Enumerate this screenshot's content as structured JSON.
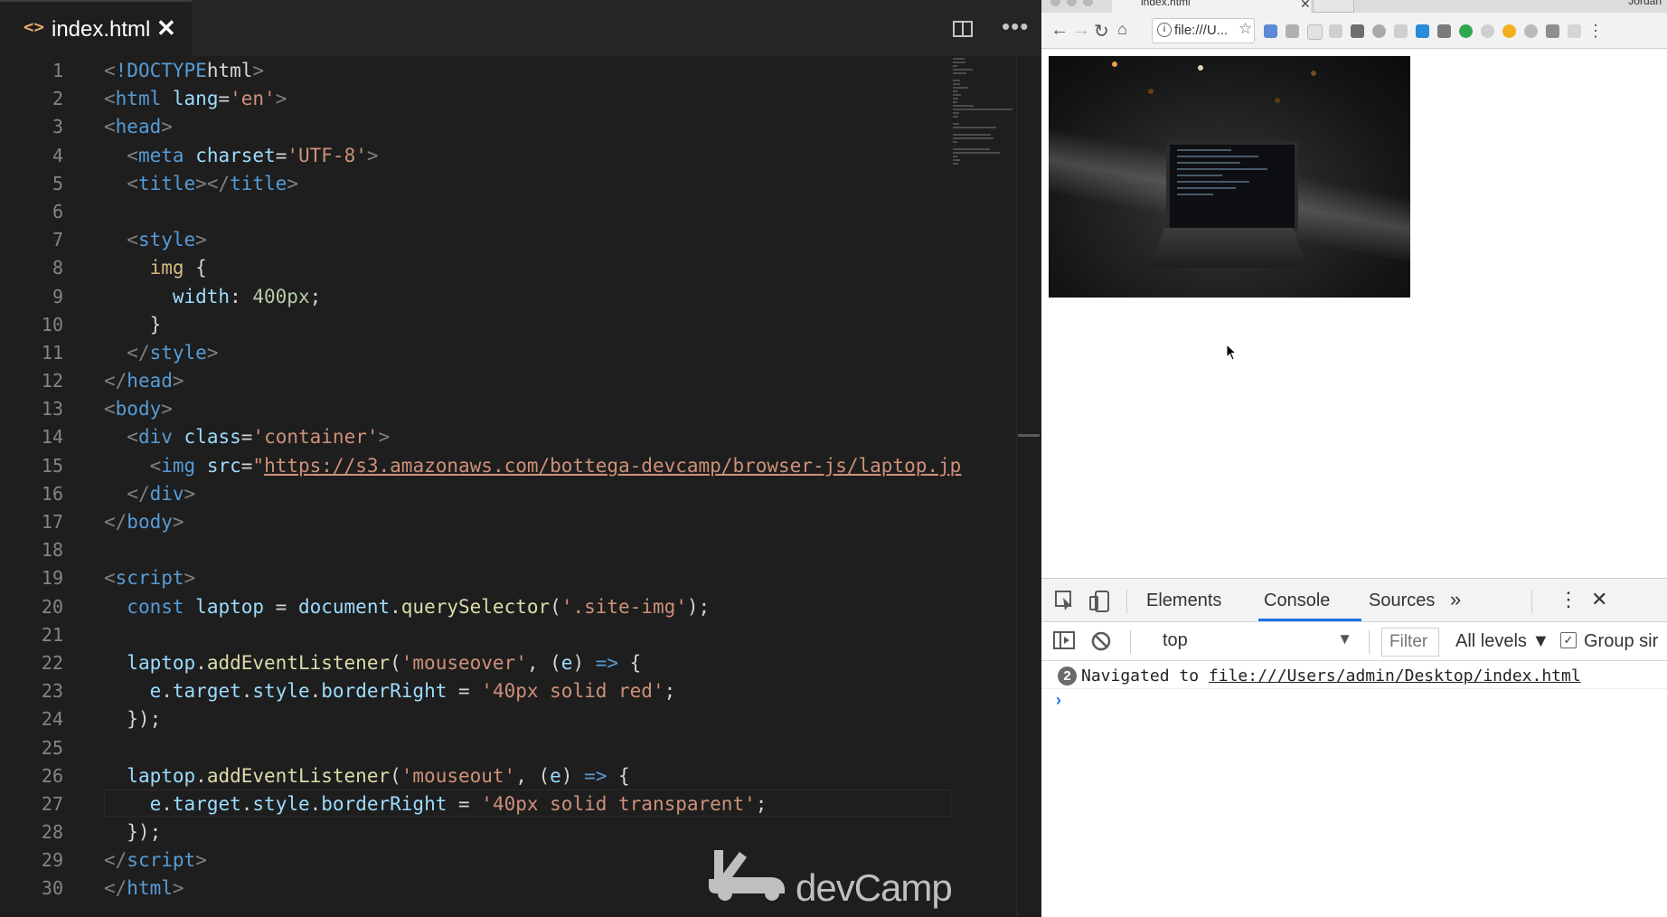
{
  "editor": {
    "tab": {
      "title": "index.html"
    },
    "lines": [
      [
        [
          "t-punc",
          "<"
        ],
        [
          "t-tag",
          "!DOCTYPE"
        ],
        [
          "",
          "html"
        ],
        [
          "t-punc",
          ">"
        ]
      ],
      [
        [
          "t-punc",
          "<"
        ],
        [
          "t-tag",
          "html"
        ],
        [
          "",
          " "
        ],
        [
          "t-attr",
          "lang"
        ],
        [
          "",
          "="
        ],
        [
          "t-str",
          "'en'"
        ],
        [
          "t-punc",
          ">"
        ]
      ],
      [
        [
          "t-punc",
          "<"
        ],
        [
          "t-tag",
          "head"
        ],
        [
          "t-punc",
          ">"
        ]
      ],
      [
        [
          "",
          "  "
        ],
        [
          "t-punc",
          "<"
        ],
        [
          "t-tag",
          "meta"
        ],
        [
          "",
          " "
        ],
        [
          "t-attr",
          "charset"
        ],
        [
          "",
          "="
        ],
        [
          "t-str",
          "'UTF-8'"
        ],
        [
          "t-punc",
          ">"
        ]
      ],
      [
        [
          "",
          "  "
        ],
        [
          "t-punc",
          "<"
        ],
        [
          "t-tag",
          "title"
        ],
        [
          "t-punc",
          "></"
        ],
        [
          "t-tag",
          "title"
        ],
        [
          "t-punc",
          ">"
        ]
      ],
      [],
      [
        [
          "",
          "  "
        ],
        [
          "t-punc",
          "<"
        ],
        [
          "t-tag",
          "style"
        ],
        [
          "t-punc",
          ">"
        ]
      ],
      [
        [
          "",
          "    "
        ],
        [
          "t-sel",
          "img"
        ],
        [
          "",
          " {"
        ]
      ],
      [
        [
          "",
          "      "
        ],
        [
          "t-prop",
          "width"
        ],
        [
          "",
          ": "
        ],
        [
          "t-num",
          "400px"
        ],
        [
          "",
          ";"
        ]
      ],
      [
        [
          "",
          "    }"
        ]
      ],
      [
        [
          "",
          "  "
        ],
        [
          "t-punc",
          "</"
        ],
        [
          "t-tag",
          "style"
        ],
        [
          "t-punc",
          ">"
        ]
      ],
      [
        [
          "t-punc",
          "</"
        ],
        [
          "t-tag",
          "head"
        ],
        [
          "t-punc",
          ">"
        ]
      ],
      [
        [
          "t-punc",
          "<"
        ],
        [
          "t-tag",
          "body"
        ],
        [
          "t-punc",
          ">"
        ]
      ],
      [
        [
          "",
          "  "
        ],
        [
          "t-punc",
          "<"
        ],
        [
          "t-tag",
          "div"
        ],
        [
          "",
          " "
        ],
        [
          "t-attr",
          "class"
        ],
        [
          "",
          "="
        ],
        [
          "t-str",
          "'container'"
        ],
        [
          "t-punc",
          ">"
        ]
      ],
      [
        [
          "",
          "    "
        ],
        [
          "t-punc",
          "<"
        ],
        [
          "t-tag",
          "img"
        ],
        [
          "",
          " "
        ],
        [
          "t-attr",
          "src"
        ],
        [
          "",
          "="
        ],
        [
          "t-str",
          "\""
        ],
        [
          "t-link",
          "https://s3.amazonaws.com/bottega-devcamp/browser-js/laptop.jp"
        ]
      ],
      [
        [
          "",
          "  "
        ],
        [
          "t-punc",
          "</"
        ],
        [
          "t-tag",
          "div"
        ],
        [
          "t-punc",
          ">"
        ]
      ],
      [
        [
          "t-punc",
          "</"
        ],
        [
          "t-tag",
          "body"
        ],
        [
          "t-punc",
          ">"
        ]
      ],
      [],
      [
        [
          "t-punc",
          "<"
        ],
        [
          "t-tag",
          "script"
        ],
        [
          "t-punc",
          ">"
        ]
      ],
      [
        [
          "",
          "  "
        ],
        [
          "t-kw",
          "const"
        ],
        [
          "",
          " "
        ],
        [
          "t-var",
          "laptop"
        ],
        [
          "",
          " = "
        ],
        [
          "t-var",
          "document"
        ],
        [
          "",
          "."
        ],
        [
          "t-fn",
          "querySelector"
        ],
        [
          "",
          "("
        ],
        [
          "t-str",
          "'.site-img'"
        ],
        [
          "",
          ");"
        ]
      ],
      [],
      [
        [
          "",
          "  "
        ],
        [
          "t-var",
          "laptop"
        ],
        [
          "",
          "."
        ],
        [
          "t-fn",
          "addEventListener"
        ],
        [
          "",
          "("
        ],
        [
          "t-str",
          "'mouseover'"
        ],
        [
          "",
          ", ("
        ],
        [
          "t-var",
          "e"
        ],
        [
          "",
          ") "
        ],
        [
          "t-kw",
          "=>"
        ],
        [
          "",
          " {"
        ]
      ],
      [
        [
          "",
          "    "
        ],
        [
          "t-var",
          "e"
        ],
        [
          "",
          "."
        ],
        [
          "t-var",
          "target"
        ],
        [
          "",
          "."
        ],
        [
          "t-var",
          "style"
        ],
        [
          "",
          "."
        ],
        [
          "t-var",
          "borderRight"
        ],
        [
          "",
          " = "
        ],
        [
          "t-str",
          "'40px solid red'"
        ],
        [
          "",
          ";"
        ]
      ],
      [
        [
          "",
          "  });"
        ]
      ],
      [],
      [
        [
          "",
          "  "
        ],
        [
          "t-var",
          "laptop"
        ],
        [
          "",
          "."
        ],
        [
          "t-fn",
          "addEventListener"
        ],
        [
          "",
          "("
        ],
        [
          "t-str",
          "'mouseout'"
        ],
        [
          "",
          ", ("
        ],
        [
          "t-var",
          "e"
        ],
        [
          "",
          ") "
        ],
        [
          "t-kw",
          "=>"
        ],
        [
          "",
          " {"
        ]
      ],
      [
        [
          "",
          "    "
        ],
        [
          "t-var",
          "e"
        ],
        [
          "",
          "."
        ],
        [
          "t-var",
          "target"
        ],
        [
          "",
          "."
        ],
        [
          "t-var",
          "style"
        ],
        [
          "",
          "."
        ],
        [
          "t-var",
          "borderRight"
        ],
        [
          "",
          " = "
        ],
        [
          "t-str",
          "'40px solid transparent'"
        ],
        [
          "",
          ";"
        ]
      ],
      [
        [
          "",
          "  });"
        ]
      ],
      [
        [
          "t-punc",
          "</"
        ],
        [
          "t-tag",
          "script"
        ],
        [
          "t-punc",
          ">"
        ]
      ],
      [
        [
          "t-punc",
          "</"
        ],
        [
          "t-tag",
          "html"
        ],
        [
          "t-punc",
          ">"
        ]
      ]
    ],
    "watermark": "devCamp"
  },
  "browser": {
    "tab_title": "index.html",
    "profile_name": "Jordan",
    "address": "file:///U...",
    "image_alt": "Laptop on a ledge at night"
  },
  "devtools": {
    "tabs": [
      "Elements",
      "Console",
      "Sources"
    ],
    "more": "»",
    "context": "top",
    "filter_placeholder": "Filter",
    "levels": "All levels",
    "group_label": "Group sir",
    "message": {
      "count": "2",
      "prefix": "Navigated to ",
      "url": "file:///Users/admin/Desktop/index.html"
    },
    "prompt": "›"
  },
  "colors": {
    "editor_bg": "#1e1e1e",
    "tag": "#569cd6",
    "string": "#ce9178",
    "attribute": "#9cdcfe",
    "function": "#dcdcaa",
    "number": "#b5cea8",
    "selector": "#d7ba7d",
    "devtools_accent": "#1a73e8"
  }
}
